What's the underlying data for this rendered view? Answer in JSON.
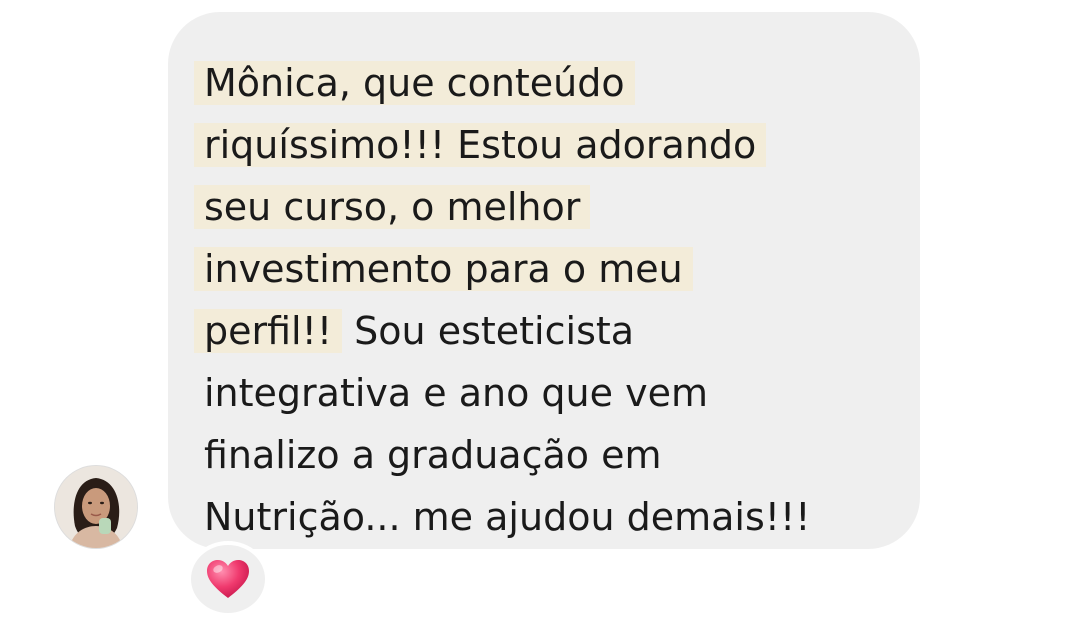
{
  "message": {
    "lines": [
      {
        "highlighted": "Mônica, que conteúdo",
        "plain": ""
      },
      {
        "highlighted": "riquíssimo!!! Estou adorando",
        "plain": ""
      },
      {
        "highlighted": "seu curso, o melhor",
        "plain": ""
      },
      {
        "highlighted": "investimento para o meu",
        "plain": ""
      },
      {
        "highlighted": "perfil!!",
        "plain": " Sou esteticista"
      },
      {
        "highlighted": "",
        "plain": "integrativa e ano que vem"
      },
      {
        "highlighted": "",
        "plain": "finalizo a graduação em"
      },
      {
        "highlighted": "",
        "plain": "Nutrição... me ajudou demais!!!"
      }
    ]
  },
  "sender": {
    "avatar_icon": "profile-photo"
  },
  "reaction": {
    "emoji": "heart",
    "color": "#f03a6e"
  },
  "colors": {
    "bubble": "#efefef",
    "highlight": "#f3ecd9",
    "text": "#1a1a1a"
  }
}
